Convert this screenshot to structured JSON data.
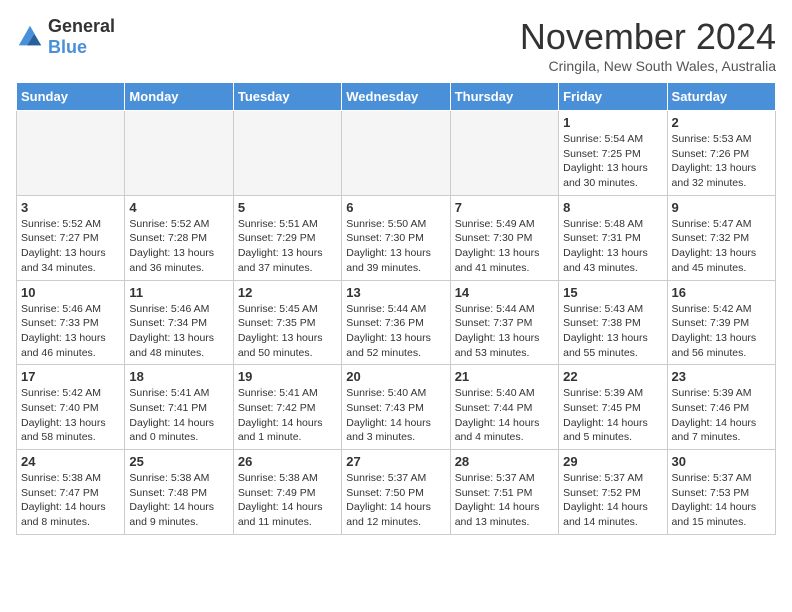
{
  "logo": {
    "general": "General",
    "blue": "Blue"
  },
  "title": "November 2024",
  "location": "Cringila, New South Wales, Australia",
  "days_of_week": [
    "Sunday",
    "Monday",
    "Tuesday",
    "Wednesday",
    "Thursday",
    "Friday",
    "Saturday"
  ],
  "weeks": [
    [
      {
        "day": "",
        "empty": true
      },
      {
        "day": "",
        "empty": true
      },
      {
        "day": "",
        "empty": true
      },
      {
        "day": "",
        "empty": true
      },
      {
        "day": "",
        "empty": true
      },
      {
        "day": "1",
        "sunrise": "5:54 AM",
        "sunset": "7:25 PM",
        "daylight": "13 hours and 30 minutes."
      },
      {
        "day": "2",
        "sunrise": "5:53 AM",
        "sunset": "7:26 PM",
        "daylight": "13 hours and 32 minutes."
      }
    ],
    [
      {
        "day": "3",
        "sunrise": "5:52 AM",
        "sunset": "7:27 PM",
        "daylight": "13 hours and 34 minutes."
      },
      {
        "day": "4",
        "sunrise": "5:52 AM",
        "sunset": "7:28 PM",
        "daylight": "13 hours and 36 minutes."
      },
      {
        "day": "5",
        "sunrise": "5:51 AM",
        "sunset": "7:29 PM",
        "daylight": "13 hours and 37 minutes."
      },
      {
        "day": "6",
        "sunrise": "5:50 AM",
        "sunset": "7:30 PM",
        "daylight": "13 hours and 39 minutes."
      },
      {
        "day": "7",
        "sunrise": "5:49 AM",
        "sunset": "7:30 PM",
        "daylight": "13 hours and 41 minutes."
      },
      {
        "day": "8",
        "sunrise": "5:48 AM",
        "sunset": "7:31 PM",
        "daylight": "13 hours and 43 minutes."
      },
      {
        "day": "9",
        "sunrise": "5:47 AM",
        "sunset": "7:32 PM",
        "daylight": "13 hours and 45 minutes."
      }
    ],
    [
      {
        "day": "10",
        "sunrise": "5:46 AM",
        "sunset": "7:33 PM",
        "daylight": "13 hours and 46 minutes."
      },
      {
        "day": "11",
        "sunrise": "5:46 AM",
        "sunset": "7:34 PM",
        "daylight": "13 hours and 48 minutes."
      },
      {
        "day": "12",
        "sunrise": "5:45 AM",
        "sunset": "7:35 PM",
        "daylight": "13 hours and 50 minutes."
      },
      {
        "day": "13",
        "sunrise": "5:44 AM",
        "sunset": "7:36 PM",
        "daylight": "13 hours and 52 minutes."
      },
      {
        "day": "14",
        "sunrise": "5:44 AM",
        "sunset": "7:37 PM",
        "daylight": "13 hours and 53 minutes."
      },
      {
        "day": "15",
        "sunrise": "5:43 AM",
        "sunset": "7:38 PM",
        "daylight": "13 hours and 55 minutes."
      },
      {
        "day": "16",
        "sunrise": "5:42 AM",
        "sunset": "7:39 PM",
        "daylight": "13 hours and 56 minutes."
      }
    ],
    [
      {
        "day": "17",
        "sunrise": "5:42 AM",
        "sunset": "7:40 PM",
        "daylight": "13 hours and 58 minutes."
      },
      {
        "day": "18",
        "sunrise": "5:41 AM",
        "sunset": "7:41 PM",
        "daylight": "14 hours and 0 minutes."
      },
      {
        "day": "19",
        "sunrise": "5:41 AM",
        "sunset": "7:42 PM",
        "daylight": "14 hours and 1 minute."
      },
      {
        "day": "20",
        "sunrise": "5:40 AM",
        "sunset": "7:43 PM",
        "daylight": "14 hours and 3 minutes."
      },
      {
        "day": "21",
        "sunrise": "5:40 AM",
        "sunset": "7:44 PM",
        "daylight": "14 hours and 4 minutes."
      },
      {
        "day": "22",
        "sunrise": "5:39 AM",
        "sunset": "7:45 PM",
        "daylight": "14 hours and 5 minutes."
      },
      {
        "day": "23",
        "sunrise": "5:39 AM",
        "sunset": "7:46 PM",
        "daylight": "14 hours and 7 minutes."
      }
    ],
    [
      {
        "day": "24",
        "sunrise": "5:38 AM",
        "sunset": "7:47 PM",
        "daylight": "14 hours and 8 minutes."
      },
      {
        "day": "25",
        "sunrise": "5:38 AM",
        "sunset": "7:48 PM",
        "daylight": "14 hours and 9 minutes."
      },
      {
        "day": "26",
        "sunrise": "5:38 AM",
        "sunset": "7:49 PM",
        "daylight": "14 hours and 11 minutes."
      },
      {
        "day": "27",
        "sunrise": "5:37 AM",
        "sunset": "7:50 PM",
        "daylight": "14 hours and 12 minutes."
      },
      {
        "day": "28",
        "sunrise": "5:37 AM",
        "sunset": "7:51 PM",
        "daylight": "14 hours and 13 minutes."
      },
      {
        "day": "29",
        "sunrise": "5:37 AM",
        "sunset": "7:52 PM",
        "daylight": "14 hours and 14 minutes."
      },
      {
        "day": "30",
        "sunrise": "5:37 AM",
        "sunset": "7:53 PM",
        "daylight": "14 hours and 15 minutes."
      }
    ]
  ]
}
